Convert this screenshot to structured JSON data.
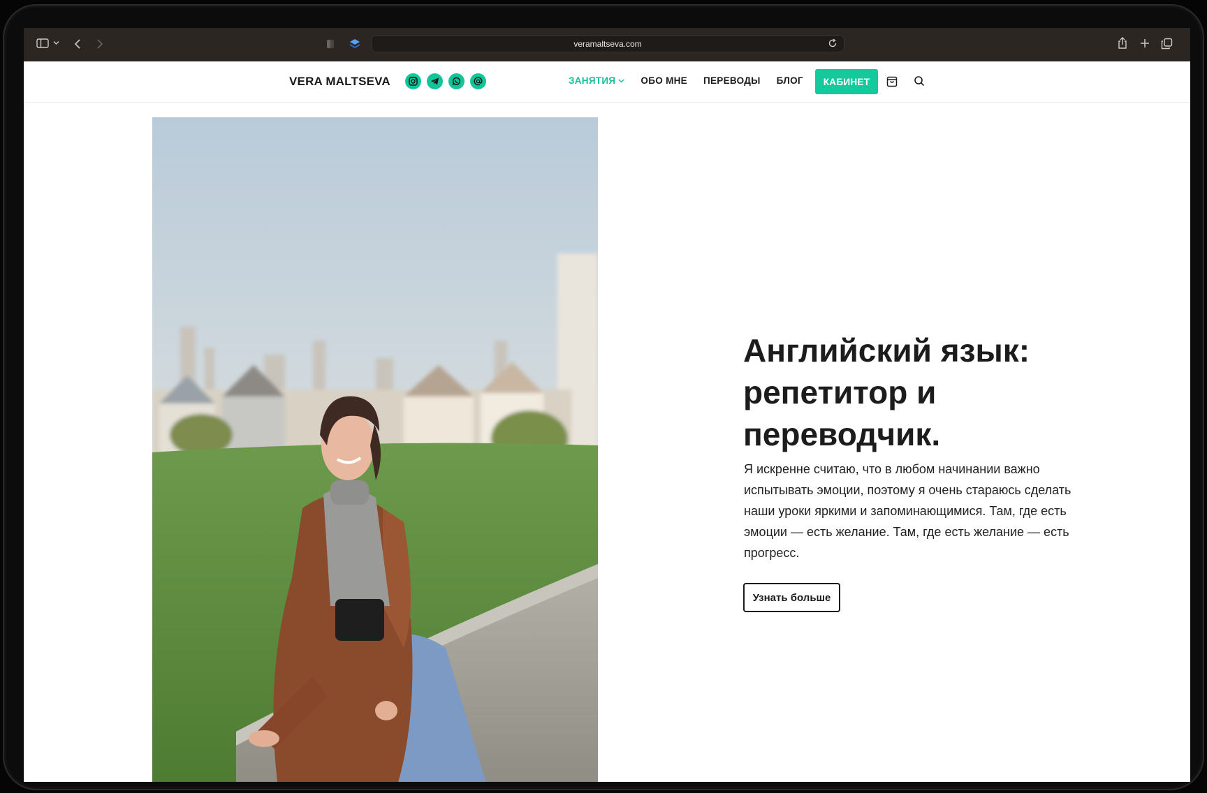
{
  "browser": {
    "url": "veramaltseva.com"
  },
  "header": {
    "logo": "VERA MALTSEVA",
    "socials": [
      "instagram-icon",
      "telegram-icon",
      "whatsapp-icon",
      "email-icon"
    ],
    "nav": [
      {
        "label": "ЗАНЯТИЯ",
        "active": true,
        "dropdown": true
      },
      {
        "label": "ОБО МНЕ"
      },
      {
        "label": "ПЕРЕВОДЫ"
      },
      {
        "label": "БЛОГ"
      }
    ],
    "cabinet_label": "КАБИНЕТ",
    "accent_color": "#14c99c"
  },
  "hero": {
    "title": "Английский язык: репетитор и переводчик.",
    "text": "Я искренне считаю, что в любом начинании важно испытывать эмоции, поэтому я очень стараюсь сделать наши уроки яркими и запоминающимися. Там, где есть эмоции — есть желание. Там, где есть желание — есть прогресс.",
    "button_label": "Узнать больше"
  }
}
